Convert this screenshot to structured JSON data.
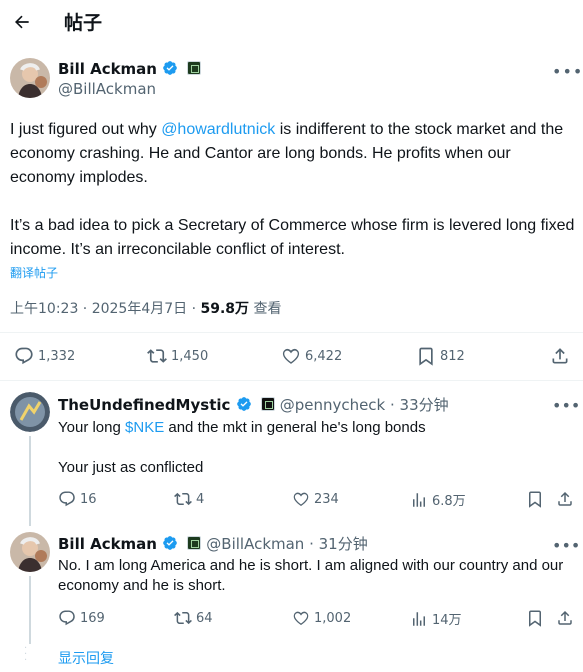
{
  "header": {
    "title": "帖子",
    "back_icon": "arrow-left-icon"
  },
  "tweet": {
    "author_name": "Bill Ackman",
    "handle": "@BillAckman",
    "text_before_mention": "I just figured out why ",
    "mention": "@howardlutnick",
    "text_after_mention": " is indifferent to the stock market and the economy crashing. He and Cantor are long bonds. He profits when our economy implodes.",
    "paragraph2": "It’s a bad idea to pick a Secretary of Commerce whose firm is levered long fixed income. It’s an irreconcilable conflict of interest.",
    "translate_label": "翻译帖子",
    "time": "上午10:23 · 2025年4月7日 · ",
    "views": "59.8万",
    "views_label": " 查看",
    "stats": {
      "replies": "1,332",
      "reposts": "1,450",
      "likes": "6,422",
      "bookmarks": "812"
    }
  },
  "replies": [
    {
      "author_name": "TheUndefinedMystic",
      "handle": "@pennycheck",
      "time": " · 33分钟",
      "text_before": "Your long ",
      "cashtag": "$NKE",
      "text_after": " and the mkt in general  he's long bonds",
      "text2": "Your just as conflicted",
      "stats": {
        "replies": "16",
        "reposts": "4",
        "likes": "234",
        "views": "6.8万"
      }
    },
    {
      "author_name": "Bill Ackman",
      "handle": "@BillAckman",
      "time": " · 31分钟",
      "text": "No. I am long America and he is short. I am aligned with our country and our economy and he is short.",
      "stats": {
        "replies": "169",
        "reposts": "64",
        "likes": "1,002",
        "views": "14万"
      }
    }
  ],
  "show_replies_label": "显示回复",
  "colors": {
    "accent": "#1d9bf0",
    "secondary_text": "#536471",
    "primary_text": "#0f1419"
  }
}
